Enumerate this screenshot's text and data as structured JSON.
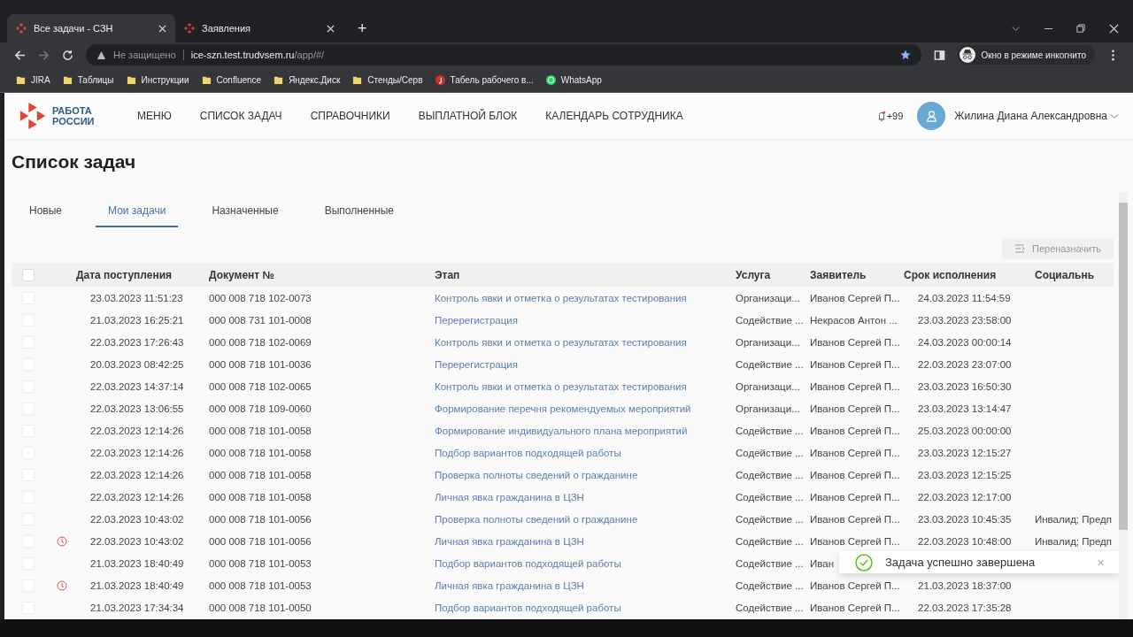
{
  "browser": {
    "tabs": [
      {
        "title": "Все задачи - СЗН",
        "selected": true
      },
      {
        "title": "Заявления",
        "selected": false
      }
    ],
    "new_tab": "+",
    "address": {
      "security": "Не защищено",
      "host": "ice-szn.test.trudvsem.ru",
      "path": "/app/#/"
    },
    "profile": "Окно в режиме инкогнито",
    "bookmarks": [
      {
        "label": "JIRA",
        "kind": "folder"
      },
      {
        "label": "Таблицы",
        "kind": "folder"
      },
      {
        "label": "Инструкции",
        "kind": "folder"
      },
      {
        "label": "Confluence",
        "kind": "folder"
      },
      {
        "label": "Яндекс.Диск",
        "kind": "folder"
      },
      {
        "label": "Стенды/Серв",
        "kind": "folder"
      },
      {
        "label": "Табель рабочего в...",
        "kind": "site"
      },
      {
        "label": "WhatsApp",
        "kind": "chat"
      }
    ]
  },
  "header": {
    "logo": [
      "РАБОТА",
      "РОССИИ"
    ],
    "menu": [
      "МЕНЮ",
      "СПИСОК ЗАДАЧ",
      "СПРАВОЧНИКИ",
      "ВЫПЛАТНОЙ БЛОК",
      "КАЛЕНДАРЬ СОТРУДНИКА"
    ],
    "notifications": "+99",
    "user": "Жилина Диана Александровна"
  },
  "page_title": "Список задач",
  "tabs": [
    {
      "label": "Новые",
      "selected": false
    },
    {
      "label": "Мои задачи",
      "selected": true
    },
    {
      "label": "Назначенные",
      "selected": false
    },
    {
      "label": "Выполненные",
      "selected": false
    }
  ],
  "reassign_button": {
    "label": "Переназначить",
    "disabled": true
  },
  "table": {
    "all_checked": false,
    "columns": [
      "Дата поступления",
      "Документ №",
      "Этап",
      "Услуга",
      "Заявитель",
      "Срок исполнения",
      "Социальнь"
    ],
    "rows": [
      {
        "checked": false,
        "overdue": false,
        "date": "23.03.2023 11:51:23",
        "doc": "000 008 718 102-0073",
        "stage": "Контроль явки и отметка о результатах тестирования",
        "service": "Организаци...",
        "applicant": "Иванов Сергей П...",
        "deadline": "24.03.2023 11:54:59",
        "social": ""
      },
      {
        "checked": false,
        "overdue": false,
        "date": "21.03.2023 16:25:21",
        "doc": "000 008 731 101-0008",
        "stage": "Перерегистрация",
        "service": "Содействие ...",
        "applicant": "Некрасов Антон ...",
        "deadline": "23.03.2023 23:58:00",
        "social": ""
      },
      {
        "checked": false,
        "overdue": false,
        "date": "22.03.2023 17:26:43",
        "doc": "000 008 718 102-0069",
        "stage": "Контроль явки и отметка о результатах тестирования",
        "service": "Организаци...",
        "applicant": "Иванов Сергей П...",
        "deadline": "24.03.2023 00:00:14",
        "social": ""
      },
      {
        "checked": false,
        "overdue": false,
        "date": "20.03.2023 08:42:25",
        "doc": "000 008 718 101-0036",
        "stage": "Перерегистрация",
        "service": "Содействие ...",
        "applicant": "Иванов Сергей П...",
        "deadline": "22.03.2023 23:07:00",
        "social": ""
      },
      {
        "checked": false,
        "overdue": false,
        "date": "22.03.2023 14:37:14",
        "doc": "000 008 718 102-0065",
        "stage": "Контроль явки и отметка о результатах тестирования",
        "service": "Организаци...",
        "applicant": "Иванов Сергей П...",
        "deadline": "23.03.2023 16:50:30",
        "social": ""
      },
      {
        "checked": false,
        "overdue": false,
        "date": "22.03.2023 13:06:55",
        "doc": "000 008 718 109-0060",
        "stage": "Формирование перечня рекомендуемых мероприятий",
        "service": "Организаци...",
        "applicant": "Иванов Сергей П...",
        "deadline": "23.03.2023 13:14:47",
        "social": ""
      },
      {
        "checked": false,
        "overdue": false,
        "date": "22.03.2023 12:14:26",
        "doc": "000 008 718 101-0058",
        "stage": "Формирование индивидуального плана мероприятий",
        "service": "Содействие ...",
        "applicant": "Иванов Сергей П...",
        "deadline": "25.03.2023 00:00:00",
        "social": ""
      },
      {
        "checked": false,
        "overdue": false,
        "date": "22.03.2023 12:14:26",
        "doc": "000 008 718 101-0058",
        "stage": "Подбор вариантов подходящей работы",
        "service": "Содействие ...",
        "applicant": "Иванов Сергей П...",
        "deadline": "23.03.2023 12:15:27",
        "social": ""
      },
      {
        "checked": false,
        "overdue": false,
        "date": "22.03.2023 12:14:26",
        "doc": "000 008 718 101-0058",
        "stage": "Проверка полноты сведений о гражданине",
        "service": "Содействие ...",
        "applicant": "Иванов Сергей П...",
        "deadline": "23.03.2023 12:15:25",
        "social": ""
      },
      {
        "checked": false,
        "overdue": false,
        "date": "22.03.2023 12:14:26",
        "doc": "000 008 718 101-0058",
        "stage": "Личная явка гражданина в ЦЗН",
        "service": "Содействие ...",
        "applicant": "Иванов Сергей П...",
        "deadline": "22.03.2023 12:17:00",
        "social": ""
      },
      {
        "checked": false,
        "overdue": false,
        "date": "22.03.2023 10:43:02",
        "doc": "000 008 718 101-0056",
        "stage": "Проверка полноты сведений о гражданине",
        "service": "Содействие ...",
        "applicant": "Иванов Сергей П...",
        "deadline": "23.03.2023 10:45:35",
        "social": "Инвалид; Предп"
      },
      {
        "checked": false,
        "overdue": true,
        "date": "22.03.2023 10:43:02",
        "doc": "000 008 718 101-0056",
        "stage": "Личная явка гражданина в ЦЗН",
        "service": "Содействие ...",
        "applicant": "Иванов Сергей П...",
        "deadline": "22.03.2023 10:48:00",
        "social": "Инвалид; Предп"
      },
      {
        "checked": false,
        "overdue": false,
        "date": "21.03.2023 18:40:49",
        "doc": "000 008 718 101-0053",
        "stage": "Подбор вариантов подходящей работы",
        "service": "Содействие ...",
        "applicant": "Иван",
        "deadline": "",
        "social": ""
      },
      {
        "checked": false,
        "overdue": true,
        "date": "21.03.2023 18:40:49",
        "doc": "000 008 718 101-0053",
        "stage": "Личная явка гражданина в ЦЗН",
        "service": "Содействие ...",
        "applicant": "Иванов Сергей П...",
        "deadline": "21.03.2023 18:37:00",
        "social": ""
      },
      {
        "checked": false,
        "overdue": false,
        "date": "21.03.2023 17:34:34",
        "doc": "000 008 718 101-0050",
        "stage": "Подбор вариантов подходящей работы",
        "service": "Содействие ...",
        "applicant": "Иванов Сергей П...",
        "deadline": "22.03.2023 17:35:28",
        "social": ""
      }
    ]
  },
  "toast": {
    "message": "Задача успешно завершена",
    "kind": "success",
    "close": "×"
  }
}
